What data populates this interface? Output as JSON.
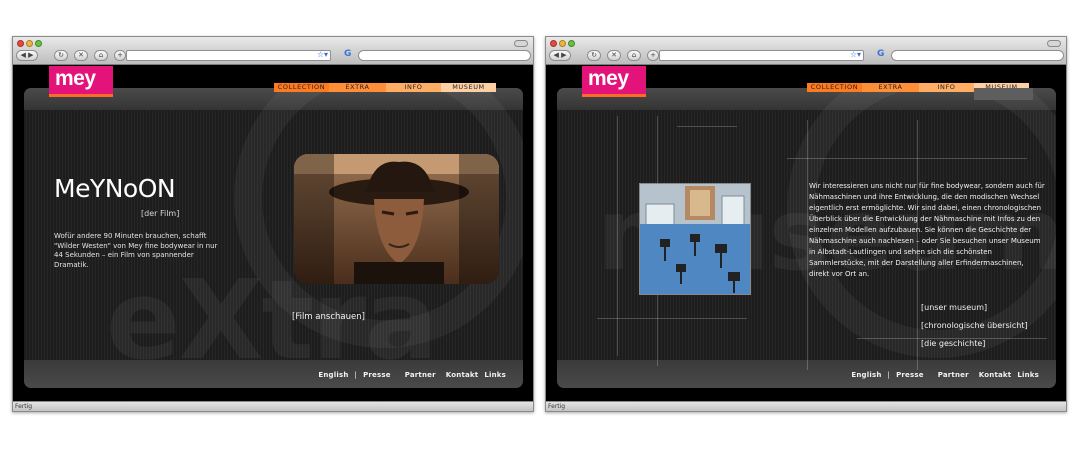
{
  "browser_left": {
    "status": "Fertig"
  },
  "browser_right": {
    "status": "Fertig"
  },
  "site": {
    "logo": "mey",
    "nav": [
      "COLLECTION",
      "EXTRA",
      "INFO",
      "MUSEUM"
    ],
    "footer": [
      "English",
      "|",
      "Presse",
      "Partner",
      "Kontakt",
      "Links"
    ],
    "colors": {
      "logo": "#e3137a",
      "logo_underline": "#ff6a2a",
      "nav1": "#ff7a1f",
      "nav2": "#ff8e36",
      "nav3": "#ffad63",
      "nav4": "#ffcfa4"
    }
  },
  "left_page": {
    "watermark": "eXtra",
    "title": "MeYNoON",
    "subtitle": "[der Film]",
    "description": "Wofür andere 90 Minuten brauchen, schafft \"Wilder Westen\" von Mey fine bodywear in nur 44 Sekunden – ein Film von spannender Dramatik.",
    "film_link": "[Film anschauen]"
  },
  "right_page": {
    "watermark": "museum",
    "text": "Wir interessieren uns nicht nur für fine bodywear, sondern auch für Nähmaschinen und ihre Entwicklung, die den modischen Wechsel eigentlich erst ermöglichte. Wir sind dabei, einen chronologischen Überblick über die Entwicklung der Nähmaschine mit Infos zu den einzelnen Modellen aufzubauen. Sie können die Geschichte der Nähmaschine auch nachlesen – oder Sie besuchen unser Museum in Albstadt-Lautlingen und sehen sich die schönsten Sammlerstücke, mit der Darstellung aller Erfindermaschinen, direkt vor Ort an.",
    "links": [
      "[unser museum]",
      "[chronologische übersicht]",
      "[die geschichte]"
    ]
  }
}
